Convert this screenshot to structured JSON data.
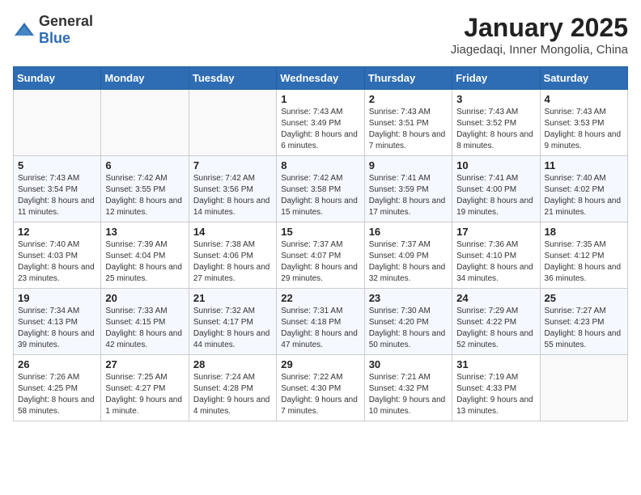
{
  "logo": {
    "general": "General",
    "blue": "Blue"
  },
  "title": "January 2025",
  "subtitle": "Jiagedaqi, Inner Mongolia, China",
  "weekdays": [
    "Sunday",
    "Monday",
    "Tuesday",
    "Wednesday",
    "Thursday",
    "Friday",
    "Saturday"
  ],
  "weeks": [
    [
      {
        "day": "",
        "sunrise": "",
        "sunset": "",
        "daylight": ""
      },
      {
        "day": "",
        "sunrise": "",
        "sunset": "",
        "daylight": ""
      },
      {
        "day": "",
        "sunrise": "",
        "sunset": "",
        "daylight": ""
      },
      {
        "day": "1",
        "sunrise": "Sunrise: 7:43 AM",
        "sunset": "Sunset: 3:49 PM",
        "daylight": "Daylight: 8 hours and 6 minutes."
      },
      {
        "day": "2",
        "sunrise": "Sunrise: 7:43 AM",
        "sunset": "Sunset: 3:51 PM",
        "daylight": "Daylight: 8 hours and 7 minutes."
      },
      {
        "day": "3",
        "sunrise": "Sunrise: 7:43 AM",
        "sunset": "Sunset: 3:52 PM",
        "daylight": "Daylight: 8 hours and 8 minutes."
      },
      {
        "day": "4",
        "sunrise": "Sunrise: 7:43 AM",
        "sunset": "Sunset: 3:53 PM",
        "daylight": "Daylight: 8 hours and 9 minutes."
      }
    ],
    [
      {
        "day": "5",
        "sunrise": "Sunrise: 7:43 AM",
        "sunset": "Sunset: 3:54 PM",
        "daylight": "Daylight: 8 hours and 11 minutes."
      },
      {
        "day": "6",
        "sunrise": "Sunrise: 7:42 AM",
        "sunset": "Sunset: 3:55 PM",
        "daylight": "Daylight: 8 hours and 12 minutes."
      },
      {
        "day": "7",
        "sunrise": "Sunrise: 7:42 AM",
        "sunset": "Sunset: 3:56 PM",
        "daylight": "Daylight: 8 hours and 14 minutes."
      },
      {
        "day": "8",
        "sunrise": "Sunrise: 7:42 AM",
        "sunset": "Sunset: 3:58 PM",
        "daylight": "Daylight: 8 hours and 15 minutes."
      },
      {
        "day": "9",
        "sunrise": "Sunrise: 7:41 AM",
        "sunset": "Sunset: 3:59 PM",
        "daylight": "Daylight: 8 hours and 17 minutes."
      },
      {
        "day": "10",
        "sunrise": "Sunrise: 7:41 AM",
        "sunset": "Sunset: 4:00 PM",
        "daylight": "Daylight: 8 hours and 19 minutes."
      },
      {
        "day": "11",
        "sunrise": "Sunrise: 7:40 AM",
        "sunset": "Sunset: 4:02 PM",
        "daylight": "Daylight: 8 hours and 21 minutes."
      }
    ],
    [
      {
        "day": "12",
        "sunrise": "Sunrise: 7:40 AM",
        "sunset": "Sunset: 4:03 PM",
        "daylight": "Daylight: 8 hours and 23 minutes."
      },
      {
        "day": "13",
        "sunrise": "Sunrise: 7:39 AM",
        "sunset": "Sunset: 4:04 PM",
        "daylight": "Daylight: 8 hours and 25 minutes."
      },
      {
        "day": "14",
        "sunrise": "Sunrise: 7:38 AM",
        "sunset": "Sunset: 4:06 PM",
        "daylight": "Daylight: 8 hours and 27 minutes."
      },
      {
        "day": "15",
        "sunrise": "Sunrise: 7:37 AM",
        "sunset": "Sunset: 4:07 PM",
        "daylight": "Daylight: 8 hours and 29 minutes."
      },
      {
        "day": "16",
        "sunrise": "Sunrise: 7:37 AM",
        "sunset": "Sunset: 4:09 PM",
        "daylight": "Daylight: 8 hours and 32 minutes."
      },
      {
        "day": "17",
        "sunrise": "Sunrise: 7:36 AM",
        "sunset": "Sunset: 4:10 PM",
        "daylight": "Daylight: 8 hours and 34 minutes."
      },
      {
        "day": "18",
        "sunrise": "Sunrise: 7:35 AM",
        "sunset": "Sunset: 4:12 PM",
        "daylight": "Daylight: 8 hours and 36 minutes."
      }
    ],
    [
      {
        "day": "19",
        "sunrise": "Sunrise: 7:34 AM",
        "sunset": "Sunset: 4:13 PM",
        "daylight": "Daylight: 8 hours and 39 minutes."
      },
      {
        "day": "20",
        "sunrise": "Sunrise: 7:33 AM",
        "sunset": "Sunset: 4:15 PM",
        "daylight": "Daylight: 8 hours and 42 minutes."
      },
      {
        "day": "21",
        "sunrise": "Sunrise: 7:32 AM",
        "sunset": "Sunset: 4:17 PM",
        "daylight": "Daylight: 8 hours and 44 minutes."
      },
      {
        "day": "22",
        "sunrise": "Sunrise: 7:31 AM",
        "sunset": "Sunset: 4:18 PM",
        "daylight": "Daylight: 8 hours and 47 minutes."
      },
      {
        "day": "23",
        "sunrise": "Sunrise: 7:30 AM",
        "sunset": "Sunset: 4:20 PM",
        "daylight": "Daylight: 8 hours and 50 minutes."
      },
      {
        "day": "24",
        "sunrise": "Sunrise: 7:29 AM",
        "sunset": "Sunset: 4:22 PM",
        "daylight": "Daylight: 8 hours and 52 minutes."
      },
      {
        "day": "25",
        "sunrise": "Sunrise: 7:27 AM",
        "sunset": "Sunset: 4:23 PM",
        "daylight": "Daylight: 8 hours and 55 minutes."
      }
    ],
    [
      {
        "day": "26",
        "sunrise": "Sunrise: 7:26 AM",
        "sunset": "Sunset: 4:25 PM",
        "daylight": "Daylight: 8 hours and 58 minutes."
      },
      {
        "day": "27",
        "sunrise": "Sunrise: 7:25 AM",
        "sunset": "Sunset: 4:27 PM",
        "daylight": "Daylight: 9 hours and 1 minute."
      },
      {
        "day": "28",
        "sunrise": "Sunrise: 7:24 AM",
        "sunset": "Sunset: 4:28 PM",
        "daylight": "Daylight: 9 hours and 4 minutes."
      },
      {
        "day": "29",
        "sunrise": "Sunrise: 7:22 AM",
        "sunset": "Sunset: 4:30 PM",
        "daylight": "Daylight: 9 hours and 7 minutes."
      },
      {
        "day": "30",
        "sunrise": "Sunrise: 7:21 AM",
        "sunset": "Sunset: 4:32 PM",
        "daylight": "Daylight: 9 hours and 10 minutes."
      },
      {
        "day": "31",
        "sunrise": "Sunrise: 7:19 AM",
        "sunset": "Sunset: 4:33 PM",
        "daylight": "Daylight: 9 hours and 13 minutes."
      },
      {
        "day": "",
        "sunrise": "",
        "sunset": "",
        "daylight": ""
      }
    ]
  ]
}
